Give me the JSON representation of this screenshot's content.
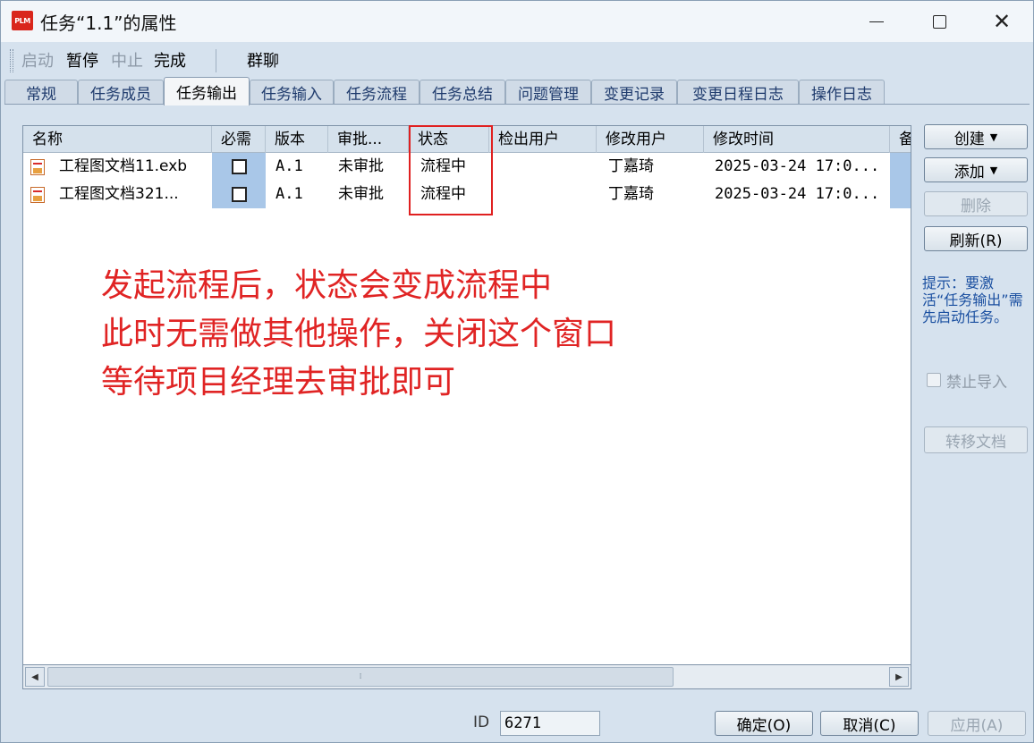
{
  "window": {
    "title": "任务“1.1”的属性",
    "app_icon_text": "PLM"
  },
  "toolbar": {
    "start": "启动",
    "pause": "暂停",
    "stop": "中止",
    "finish": "完成",
    "group_chat": "群聊"
  },
  "tabs": [
    "常规",
    "任务成员",
    "任务输出",
    "任务输入",
    "任务流程",
    "任务总结",
    "问题管理",
    "变更记录",
    "变更日程日志",
    "操作日志"
  ],
  "active_tab": "任务输出",
  "grid": {
    "columns": [
      "名称",
      "必需",
      "版本",
      "审批...",
      "状态",
      "检出用户",
      "修改用户",
      "修改时间",
      "备"
    ],
    "rows": [
      {
        "name": "工程图文档11.exb",
        "required": false,
        "version": "A.1",
        "approval": "未审批",
        "status": "流程中",
        "checkout_user": "",
        "modify_user": "丁嘉琦",
        "modify_time": "2025-03-24 17:0..."
      },
      {
        "name": "工程图文档321...",
        "required": false,
        "version": "A.1",
        "approval": "未审批",
        "status": "流程中",
        "checkout_user": "",
        "modify_user": "丁嘉琦",
        "modify_time": "2025-03-24 17:0..."
      }
    ]
  },
  "annotation": {
    "line1": "发起流程后，状态会变成流程中",
    "line2": "此时无需做其他操作，关闭这个窗口",
    "line3": "等待项目经理去审批即可"
  },
  "side": {
    "create": "创建",
    "add": "添加",
    "delete": "删除",
    "refresh": "刷新(R)",
    "hint": "提示：要激活“任务输出”需先启动任务。",
    "forbid_import": "禁止导入",
    "transfer": "转移文档"
  },
  "footer": {
    "id_label": "ID",
    "id_value": "6271",
    "ok": "确定(O)",
    "cancel": "取消(C)",
    "apply": "应用(A)"
  },
  "colors": {
    "annotation": "#e02424",
    "highlight_border": "#e02020",
    "selected_column": "#a9c7e8",
    "hint_text": "#1a4fa0"
  }
}
